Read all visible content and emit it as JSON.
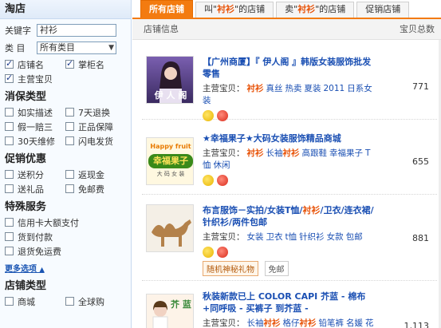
{
  "sidebar": {
    "title": "淘店",
    "keyword_label": "关键字",
    "keyword_value": "衬衫",
    "category_label": "类 目",
    "category_value": "所有类目",
    "search_fields": [
      {
        "label": "店铺名",
        "checked": true
      },
      {
        "label": "掌柜名",
        "checked": true
      },
      {
        "label": "主营宝贝",
        "checked": true
      }
    ],
    "consumer_title": "消保类型",
    "consumer_items": [
      {
        "label": "如实描述",
        "checked": false
      },
      {
        "label": "7天退换",
        "checked": false
      },
      {
        "label": "假一赔三",
        "checked": false
      },
      {
        "label": "正品保障",
        "checked": false
      },
      {
        "label": "30天维修",
        "checked": false
      },
      {
        "label": "闪电发货",
        "checked": false
      }
    ],
    "promo_title": "促销优惠",
    "promo_items": [
      {
        "label": "送积分",
        "checked": false
      },
      {
        "label": "返现金",
        "checked": false
      },
      {
        "label": "送礼品",
        "checked": false
      },
      {
        "label": "免邮费",
        "checked": false
      }
    ],
    "service_title": "特殊服务",
    "service_items": [
      {
        "label": "信用卡大额支付",
        "checked": false
      },
      {
        "label": "货到付款",
        "checked": false
      },
      {
        "label": "退货免运费",
        "checked": false
      }
    ],
    "more_label": "更多选项",
    "shop_type_title": "店铺类型",
    "shop_type_items": [
      {
        "label": "商城",
        "checked": false
      },
      {
        "label": "全球购",
        "checked": false
      }
    ]
  },
  "tabs": [
    {
      "label": "所有店铺",
      "active": true
    },
    {
      "pre": "叫\"",
      "kw": "衬衫",
      "post": "\"的店铺",
      "active": false
    },
    {
      "pre": "卖\"",
      "kw": "衬衫",
      "post": "\"的店铺",
      "active": false
    },
    {
      "label": "促销店铺",
      "active": false
    }
  ],
  "list_header": {
    "left": "店铺信息",
    "right": "宝贝总数"
  },
  "main_label": "主营宝贝：",
  "shops": [
    {
      "title": "【广州商厦】『 伊人阁 』韩版女装服饰批发零售",
      "thumb_text": "伊 人 阁",
      "tags": [
        "衬衫",
        "真丝",
        "热卖",
        "夏装",
        "2011",
        "日系女装"
      ],
      "count": "771",
      "chips": []
    },
    {
      "title": "★幸福果子★大码女装服饰精品商城",
      "thumb_text": "Happy fruit",
      "thumb_text2": "幸福果子",
      "thumb_text3": "大 码 女 装",
      "tags": [
        "衬衫",
        "长袖衬衫",
        "高跟鞋",
        "幸福果子",
        "T恤",
        "休闲"
      ],
      "count": "655",
      "chips": []
    },
    {
      "title": "布言服饰－实拍/女装T恤/衬衫/卫衣/连衣裙/针织衫/两件包邮",
      "thumb_text": "",
      "tags": [
        "女装",
        "卫衣",
        "t恤",
        "针织衫",
        "女款",
        "包邮"
      ],
      "count": "881",
      "chips": [
        "随机神秘礼物",
        "免邮"
      ]
    },
    {
      "title": "秋装新款已上 COLOR CAPI 芥蓝 - 棉布+同呼吸 - 买裤子 到芥蓝 -",
      "thumb_text": "芥 蓝",
      "tags": [
        "长袖衬衫",
        "格仔衬衫",
        "铅笔裤",
        "名媛",
        "花"
      ],
      "count": "1,113",
      "chips": []
    }
  ],
  "colors": {
    "accent": "#f37b10",
    "link": "#1a4fb3",
    "keyword": "#e8540a"
  }
}
